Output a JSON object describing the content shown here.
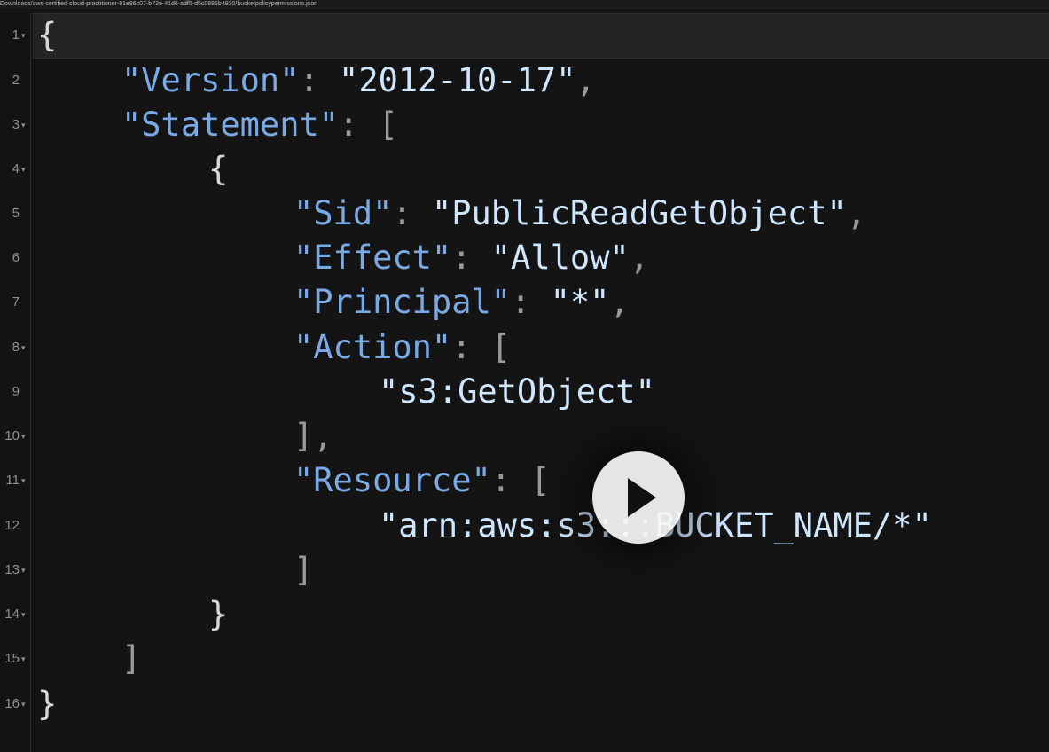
{
  "file_path": "Downloads/aws-certified-cloud-practitioner-91e86c07-b73e-41d6-adf5-d5c0885b4930/bucketpolicypermissions.json",
  "colors": {
    "key": "#7aaae6",
    "string": "#cfe6ff",
    "punctuation": "#9a9a9a",
    "brace": "#d9d9d9",
    "background": "#141414",
    "active_line": "#242424"
  },
  "player": {
    "icon": "play-icon"
  },
  "lines": [
    {
      "n": "1",
      "fold": true
    },
    {
      "n": "2",
      "fold": false,
      "key": "\"Version\"",
      "sep": ": ",
      "value": "\"2012-10-17\"",
      "trail": ","
    },
    {
      "n": "3",
      "fold": true,
      "key": "\"Statement\"",
      "sep": ": ",
      "trail": "["
    },
    {
      "n": "4",
      "fold": true,
      "open": "{"
    },
    {
      "n": "5",
      "fold": false,
      "key": "\"Sid\"",
      "sep": ": ",
      "value": "\"PublicReadGetObject\"",
      "trail": ","
    },
    {
      "n": "6",
      "fold": false,
      "key": "\"Effect\"",
      "sep": ": ",
      "value": "\"Allow\"",
      "trail": ","
    },
    {
      "n": "7",
      "fold": false,
      "key": "\"Principal\"",
      "sep": ": ",
      "value": "\"*\"",
      "trail": ","
    },
    {
      "n": "8",
      "fold": true,
      "key": "\"Action\"",
      "sep": ": ",
      "trail": "["
    },
    {
      "n": "9",
      "fold": false,
      "value": "\"s3:GetObject\""
    },
    {
      "n": "10",
      "fold": true,
      "trail": "],"
    },
    {
      "n": "11",
      "fold": true,
      "key": "\"Resource\"",
      "sep": ": ",
      "trail": "["
    },
    {
      "n": "12",
      "fold": false,
      "value": "\"arn:aws:s3:::BUCKET_NAME/*\""
    },
    {
      "n": "13",
      "fold": true,
      "trail": "]"
    },
    {
      "n": "14",
      "fold": true,
      "open": "}"
    },
    {
      "n": "15",
      "fold": true,
      "trail": "]"
    },
    {
      "n": "16",
      "fold": true,
      "open": "}"
    }
  ],
  "first_line_text": "{"
}
